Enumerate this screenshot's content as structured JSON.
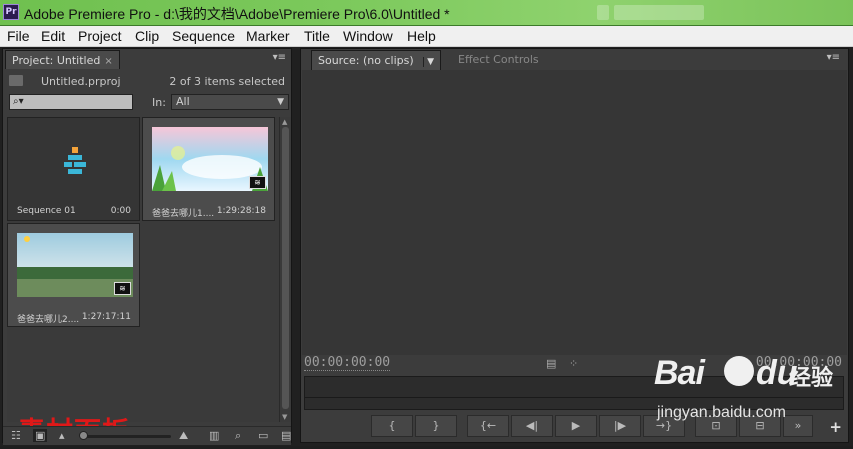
{
  "window": {
    "title": "Adobe Premiere Pro - d:\\我的文档\\Adobe\\Premiere Pro\\6.0\\Untitled *",
    "app_icon": "Pr"
  },
  "menu": [
    "File",
    "Edit",
    "Project",
    "Clip",
    "Sequence",
    "Marker",
    "Title",
    "Window",
    "Help"
  ],
  "project_panel": {
    "tab_label": "Project: Untitled",
    "project_file": "Untitled.prproj",
    "selection_status": "2 of 3 items selected",
    "search_placeholder": "⌕▾",
    "in_label": "In:",
    "in_value": "All",
    "items": [
      {
        "name": "Sequence 01",
        "duration": "0:00",
        "kind": "sequence",
        "selected": false
      },
      {
        "name": "爸爸去哪儿1....",
        "duration": "1:29:28:18",
        "kind": "video",
        "selected": true
      },
      {
        "name": "爸爸去哪儿2....",
        "duration": "1:27:17:11",
        "kind": "video",
        "selected": true
      }
    ],
    "annotation": "素材面板"
  },
  "monitor_panel": {
    "source_tab": "Source: (no clips)",
    "effect_tab": "Effect Controls",
    "timecode_in": "00:00:00:00",
    "timecode_out": "00:00:00:00"
  },
  "watermark": {
    "brand": "Bai",
    "brand2": "du",
    "cn": "经验",
    "url": "jingyan.baidu.com"
  },
  "colors": {
    "panel_bg": "#3c3c3c",
    "title_bar": "#7cc95c",
    "annotation_red": "#e01818"
  },
  "icons": {
    "close": "×",
    "panel_menu": "▾≡",
    "audio": "≋"
  }
}
